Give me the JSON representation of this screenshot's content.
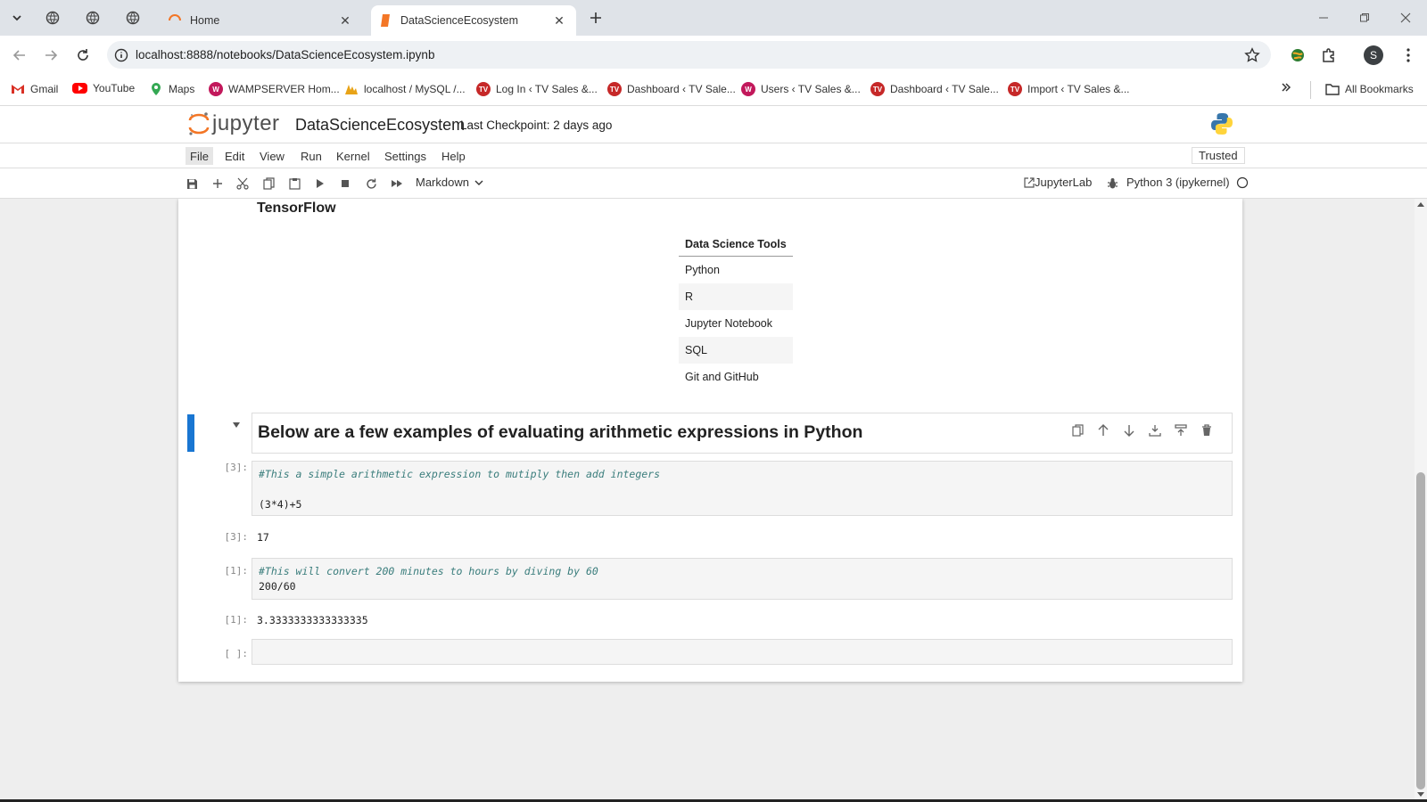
{
  "browser": {
    "tabs": [
      {
        "label": "Home",
        "active": false
      },
      {
        "label": "DataScienceEcosystem",
        "active": true
      }
    ],
    "url": "localhost:8888/notebooks/DataScienceEcosystem.ipynb",
    "profile_initial": "S",
    "bookmarks": [
      {
        "label": "Gmail",
        "color": "#d93025"
      },
      {
        "label": "YouTube",
        "color": "#ff0000"
      },
      {
        "label": "Maps",
        "color": "#34a853"
      },
      {
        "label": "WAMPSERVER Hom...",
        "color": "#c2185b"
      },
      {
        "label": "localhost / MySQL /...",
        "color": "#e8a317"
      },
      {
        "label": "Log In ‹ TV Sales &...",
        "color": "#c62828"
      },
      {
        "label": "Dashboard ‹ TV Sale...",
        "color": "#c62828"
      },
      {
        "label": "Users ‹ TV Sales &...",
        "color": "#c2185b"
      },
      {
        "label": "Dashboard ‹ TV Sale...",
        "color": "#c62828"
      },
      {
        "label": "Import ‹ TV Sales &...",
        "color": "#c62828"
      }
    ],
    "all_bookmarks": "All Bookmarks"
  },
  "jupyter": {
    "logo_text": "jupyter",
    "notebook_name": "DataScienceEcosystem",
    "checkpoint": "Last Checkpoint: 2 days ago",
    "trusted": "Trusted",
    "menu": [
      "File",
      "Edit",
      "View",
      "Run",
      "Kernel",
      "Settings",
      "Help"
    ],
    "cell_type": "Markdown",
    "jupyterlab_link": "JupyterLab",
    "kernel": "Python 3 (ipykernel)"
  },
  "notebook": {
    "partial_heading": "TensorFlow",
    "tools_table": {
      "header": "Data Science Tools",
      "rows": [
        "Python",
        "R",
        "Jupyter Notebook",
        "SQL",
        "Git and GitHub"
      ]
    },
    "md_heading": "Below are a few examples of evaluating arithmetic expressions in Python",
    "cells": [
      {
        "prompt": "[3]:",
        "comment": "#This a simple arithmetic expression to mutiply then add integers",
        "code": "(3*4)+5",
        "out_prompt": "[3]:",
        "output": "17"
      },
      {
        "prompt": "[1]:",
        "comment": "#This will convert 200 minutes to hours by diving by 60",
        "code": "200/60",
        "out_prompt": "[1]:",
        "output": "3.3333333333333335"
      }
    ],
    "empty_prompt": "[ ]:"
  }
}
